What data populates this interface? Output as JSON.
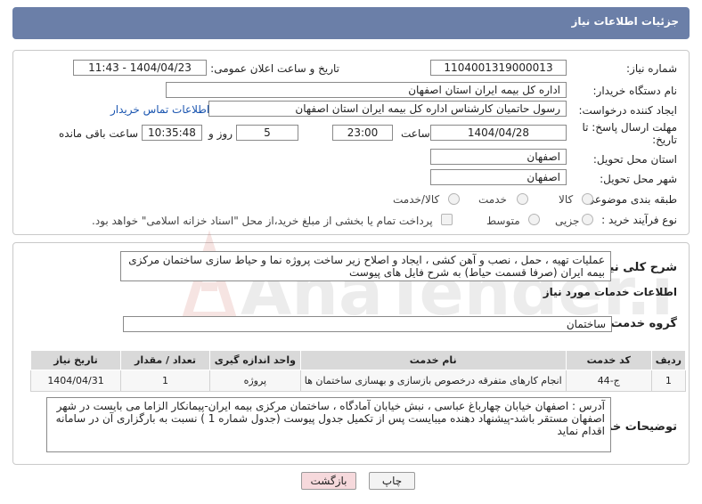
{
  "header": {
    "title": "جزئیات اطلاعات نیاز"
  },
  "form": {
    "need_number_label": "شماره نیاز:",
    "need_number": "1104001319000013",
    "announce_label": "تاریخ و ساعت اعلان عمومی:",
    "announce_value": "1404/04/23 - 11:43",
    "buyer_org_label": "نام دستگاه خریدار:",
    "buyer_org": "اداره کل بیمه ایران استان اصفهان",
    "creator_label": "ایجاد کننده درخواست:",
    "creator": "رسول  حاتمیان کارشناس اداره کل بیمه ایران استان اصفهان",
    "contact_link": "اطلاعات تماس خریدار",
    "deadline_label": "مهلت ارسال پاسخ: تا تاریخ:",
    "deadline_date": "1404/04/28",
    "time_label": "ساعت",
    "deadline_time": "23:00",
    "days_value": "5",
    "days_label": "روز و",
    "remaining_time": "10:35:48",
    "remaining_label": "ساعت باقی مانده",
    "province_label": "استان محل تحویل:",
    "province": "اصفهان",
    "city_label": "شهر محل تحویل:",
    "city": "اصفهان",
    "category_label": "طبقه بندی موضوعی:",
    "category_options": [
      "کالا",
      "خدمت",
      "کالا/خدمت"
    ],
    "process_label": "نوع فرآیند خرید :",
    "process_options": [
      "جزیی",
      "متوسط"
    ],
    "payment_note": "پرداخت تمام یا بخشی از مبلغ خرید،از محل \"اسناد خزانه اسلامی\" خواهد بود."
  },
  "description": {
    "label": "شرح کلی نیاز:",
    "text": "عملیات تهیه ، حمل ، نصب و آهن کشی ، ایجاد و اصلاح زیر ساخت پروژه نما و حیاط سازی ساختمان مرکزی بیمه ایران  (صرفا قسمت حیاط) به شرح فایل های پیوست"
  },
  "services": {
    "section_title": "اطلاعات خدمات مورد نیاز",
    "group_label": "گروه خدمت:",
    "group_value": "ساختمان",
    "columns": [
      "ردیف",
      "کد خدمت",
      "نام خدمت",
      "واحد اندازه گیری",
      "تعداد / مقدار",
      "تاریخ نیاز"
    ],
    "rows": [
      [
        "1",
        "ج-44",
        "انجام کارهای متفرقه درخصوص بازسازی و بهسازی ساختمان ها",
        "پروژه",
        "1",
        "1404/04/31"
      ]
    ]
  },
  "buyer_notes": {
    "label": "توضیحات خریدار:",
    "text": "آدرس : اصفهان خیابان چهارباغ عباسی ، نبش خیابان آمادگاه ، ساختمان مرکزی بیمه ایران-پیمانکار الزاما می بایست در شهر اصفهان مستقر باشد-پیشنهاد دهنده میبایست پس از تکمیل جدول پیوست (جدول شماره 1 )  نسبت به بارگزاری آن در سامانه اقدام نماید"
  },
  "buttons": {
    "print": "چاپ",
    "back": "بازگشت"
  },
  "watermark": {
    "text": "AnaTender.net"
  },
  "colors": {
    "header": "#6b7fa8",
    "back_button": "#f6d9dc",
    "link": "#1a55b0"
  }
}
